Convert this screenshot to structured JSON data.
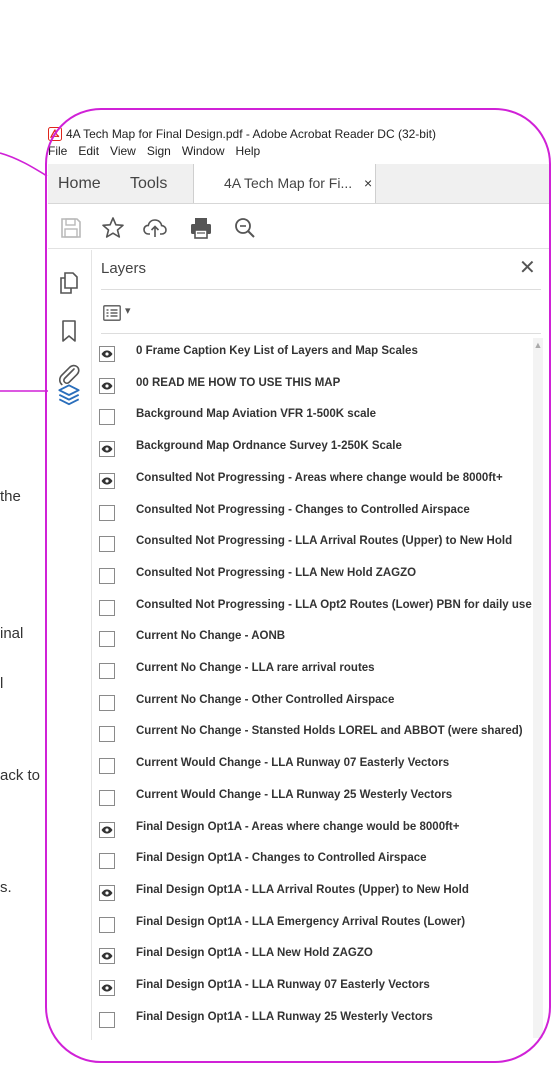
{
  "window": {
    "title": "4A Tech Map for Final Design.pdf - Adobe Acrobat Reader DC (32-bit)",
    "app_icon": "acrobat-pdf-icon"
  },
  "menu": [
    "File",
    "Edit",
    "View",
    "Sign",
    "Window",
    "Help"
  ],
  "tabs": {
    "home": "Home",
    "tools": "Tools",
    "document": "4A Tech Map for Fi...",
    "close_glyph": "×"
  },
  "toolbar": [
    "save-icon",
    "star-icon",
    "upload-cloud-icon",
    "print-icon",
    "zoom-search-icon"
  ],
  "left_rail": [
    "page-thumbnails-icon",
    "bookmark-icon",
    "attachment-paperclip-icon",
    "layers-icon"
  ],
  "layers_panel": {
    "title": "Layers",
    "close_glyph": "✕",
    "options_dropdown_glyph": "▾",
    "items": [
      {
        "label": "0 Frame Caption Key List of Layers and Map Scales",
        "visible": true
      },
      {
        "label": "00 READ ME HOW TO USE THIS MAP",
        "visible": true
      },
      {
        "label": "Background Map Aviation VFR 1-500K scale",
        "visible": false
      },
      {
        "label": "Background Map Ordnance Survey 1-250K Scale",
        "visible": true
      },
      {
        "label": "Consulted Not Progressing - Areas where change would be 8000ft+",
        "visible": true
      },
      {
        "label": "Consulted Not Progressing - Changes to Controlled Airspace",
        "visible": false
      },
      {
        "label": "Consulted Not Progressing - LLA Arrival Routes (Upper) to New Hold",
        "visible": false
      },
      {
        "label": "Consulted Not Progressing - LLA New Hold ZAGZO",
        "visible": false
      },
      {
        "label": "Consulted Not Progressing - LLA Opt2 Routes (Lower) PBN for daily use",
        "visible": false
      },
      {
        "label": "Current No Change - AONB",
        "visible": false
      },
      {
        "label": "Current No Change - LLA rare arrival routes",
        "visible": false
      },
      {
        "label": "Current No Change - Other Controlled Airspace",
        "visible": false
      },
      {
        "label": "Current No Change - Stansted Holds LOREL and ABBOT (were shared)",
        "visible": false
      },
      {
        "label": "Current Would Change - LLA Runway 07 Easterly Vectors",
        "visible": false
      },
      {
        "label": "Current Would Change - LLA Runway 25 Westerly Vectors",
        "visible": false
      },
      {
        "label": "Final Design Opt1A - Areas where change would be 8000ft+",
        "visible": true
      },
      {
        "label": "Final Design Opt1A - Changes to Controlled Airspace",
        "visible": false
      },
      {
        "label": "Final Design Opt1A - LLA Arrival Routes (Upper) to New Hold",
        "visible": true
      },
      {
        "label": "Final Design Opt1A - LLA Emergency Arrival Routes (Lower)",
        "visible": false
      },
      {
        "label": "Final Design Opt1A - LLA New Hold ZAGZO",
        "visible": true
      },
      {
        "label": "Final Design Opt1A - LLA Runway 07 Easterly Vectors",
        "visible": true
      },
      {
        "label": "Final Design Opt1A - LLA Runway 25 Westerly Vectors",
        "visible": false
      }
    ]
  },
  "background_text": [
    "the",
    "inal",
    "l",
    "ack to",
    "s."
  ],
  "colors": {
    "annotation_magenta": "#d021d7",
    "acrobat_red": "#e0261b",
    "layers_icon_blue": "#2a6ebb"
  }
}
